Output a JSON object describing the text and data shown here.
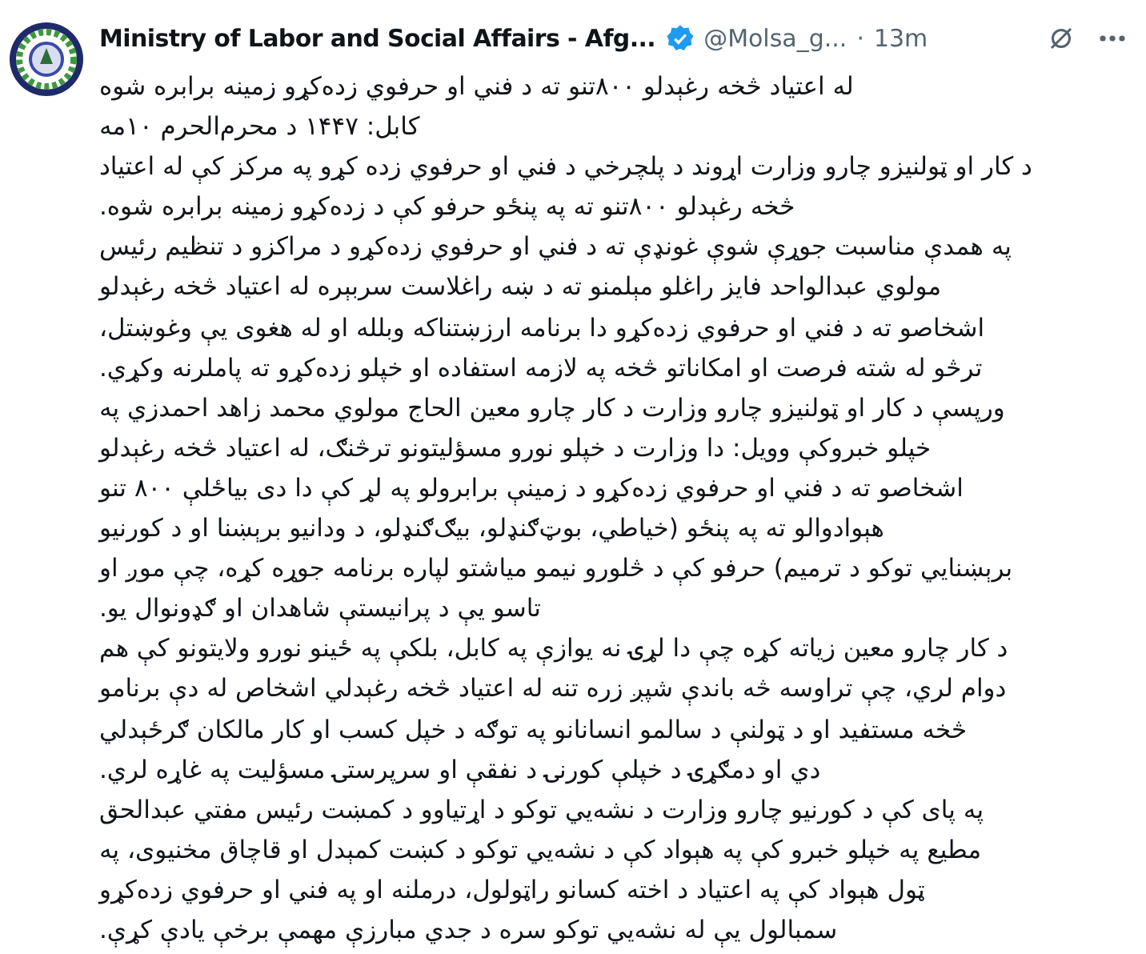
{
  "post": {
    "author": "Ministry of Labor and Social Affairs - Afg...",
    "verified": true,
    "handle": "@Molsa_g...",
    "separator": "·",
    "time": "13m",
    "lines": [
      "له اعتیاد څخه رغېدلو ۸۰۰تنو ته د فني او حرفوي زده‌کړو زمینه برابره شوه",
      "کابل: ۱۴۴۷ د محرم‌الحرم ۱۰مه",
      "د کار او ټولنیزو چارو وزارت اړوند د پلچرخي د فني او حرفوي زده کړو په مرکز کې له اعتیاد",
      "څخه رغېدلو ۸۰۰تنو ته په پنځو حرفو کې د زده‌کړو زمینه برابره شوه.",
      "په همدې مناسبت جوړې شوې غونډې ته د فني او حرفوي زده‌کړو د مراکزو د تنظیم رئیس",
      "مولوي عبدالواحد فایز راغلو مېلمنو ته د ښه راغلاست سربېره له اعتیاد څخه رغېدلو",
      "اشخاصو ته د فني او حرفوي زده‌کړو دا برنامه ارزښتناکه وبلله او له هغوی یې وغوښتل،",
      "ترڅو له شته فرصت او امکاناتو څخه په لازمه استفاده او خپلو زده‌کړو ته پاملرنه وکړي.",
      "ورپسې د کار او ټولنیزو چارو وزارت د کار چارو معین الحاج مولوي محمد زاهد احمدزي په",
      "خپلو خبروکې وویل: دا وزارت د خپلو نورو مسؤلیتونو ترڅنګ، له اعتیاد څخه رغېدلو",
      "اشخاصو ته د فني او حرفوي زده‌کړو د زمینې برابرولو په لړ کې دا دی بیاځلې ۸۰۰ تنو",
      "هېوادوالو ته په پنځو (خیاطي، بوټ‌ګنډلو، بیګ‌ګنډلو، د ودانیو برېښنا او د کورنیو",
      "برېښنایي توکو د ترمیم) حرفو کې د څلورو نیمو میاشتو لپاره برنامه جوړه کړه، چې موږ او",
      "تاسو یې د پرانیستې شاهدان او ګډونوال یو.",
      "د کار چارو معین زیاته کړه چې دا لړۍ نه یوازې په کابل، بلکې په ځینو نورو ولایتونو کې هم",
      "دوام لري، چې تراوسه څه باندې شپږ زره تنه له اعتیاد څخه رغېدلي اشخاص له دې برنامو",
      "څخه مستفید او د ټولنې د سالمو انسانانو په توګه د خپل کسب او کار مالکان ګرځېدلي",
      "دي او دمګړۍ د خپلې کورنۍ د نفقې او سرپرستۍ مسؤلیت په غاړه لري.",
      "په پای کې د کورنیو چارو وزارت د نشه‌يي توکو د اړتیاوو د کمښت رئیس مفتي عبدالحق",
      "مطیع په خپلو خبرو کې په هېواد کې د نشه‌يي توکو د کښت کمېدل او قاچاق مخنیوی، په",
      "ټول هېواد کې په اعتیاد د اخته کسانو راټولول، درملنه او په فني او حرفوي زده‌کړو",
      "سمبالول یې له نشه‌يي توکو سره د جدي مبارزې مهمې برخې یادې کړې."
    ]
  }
}
